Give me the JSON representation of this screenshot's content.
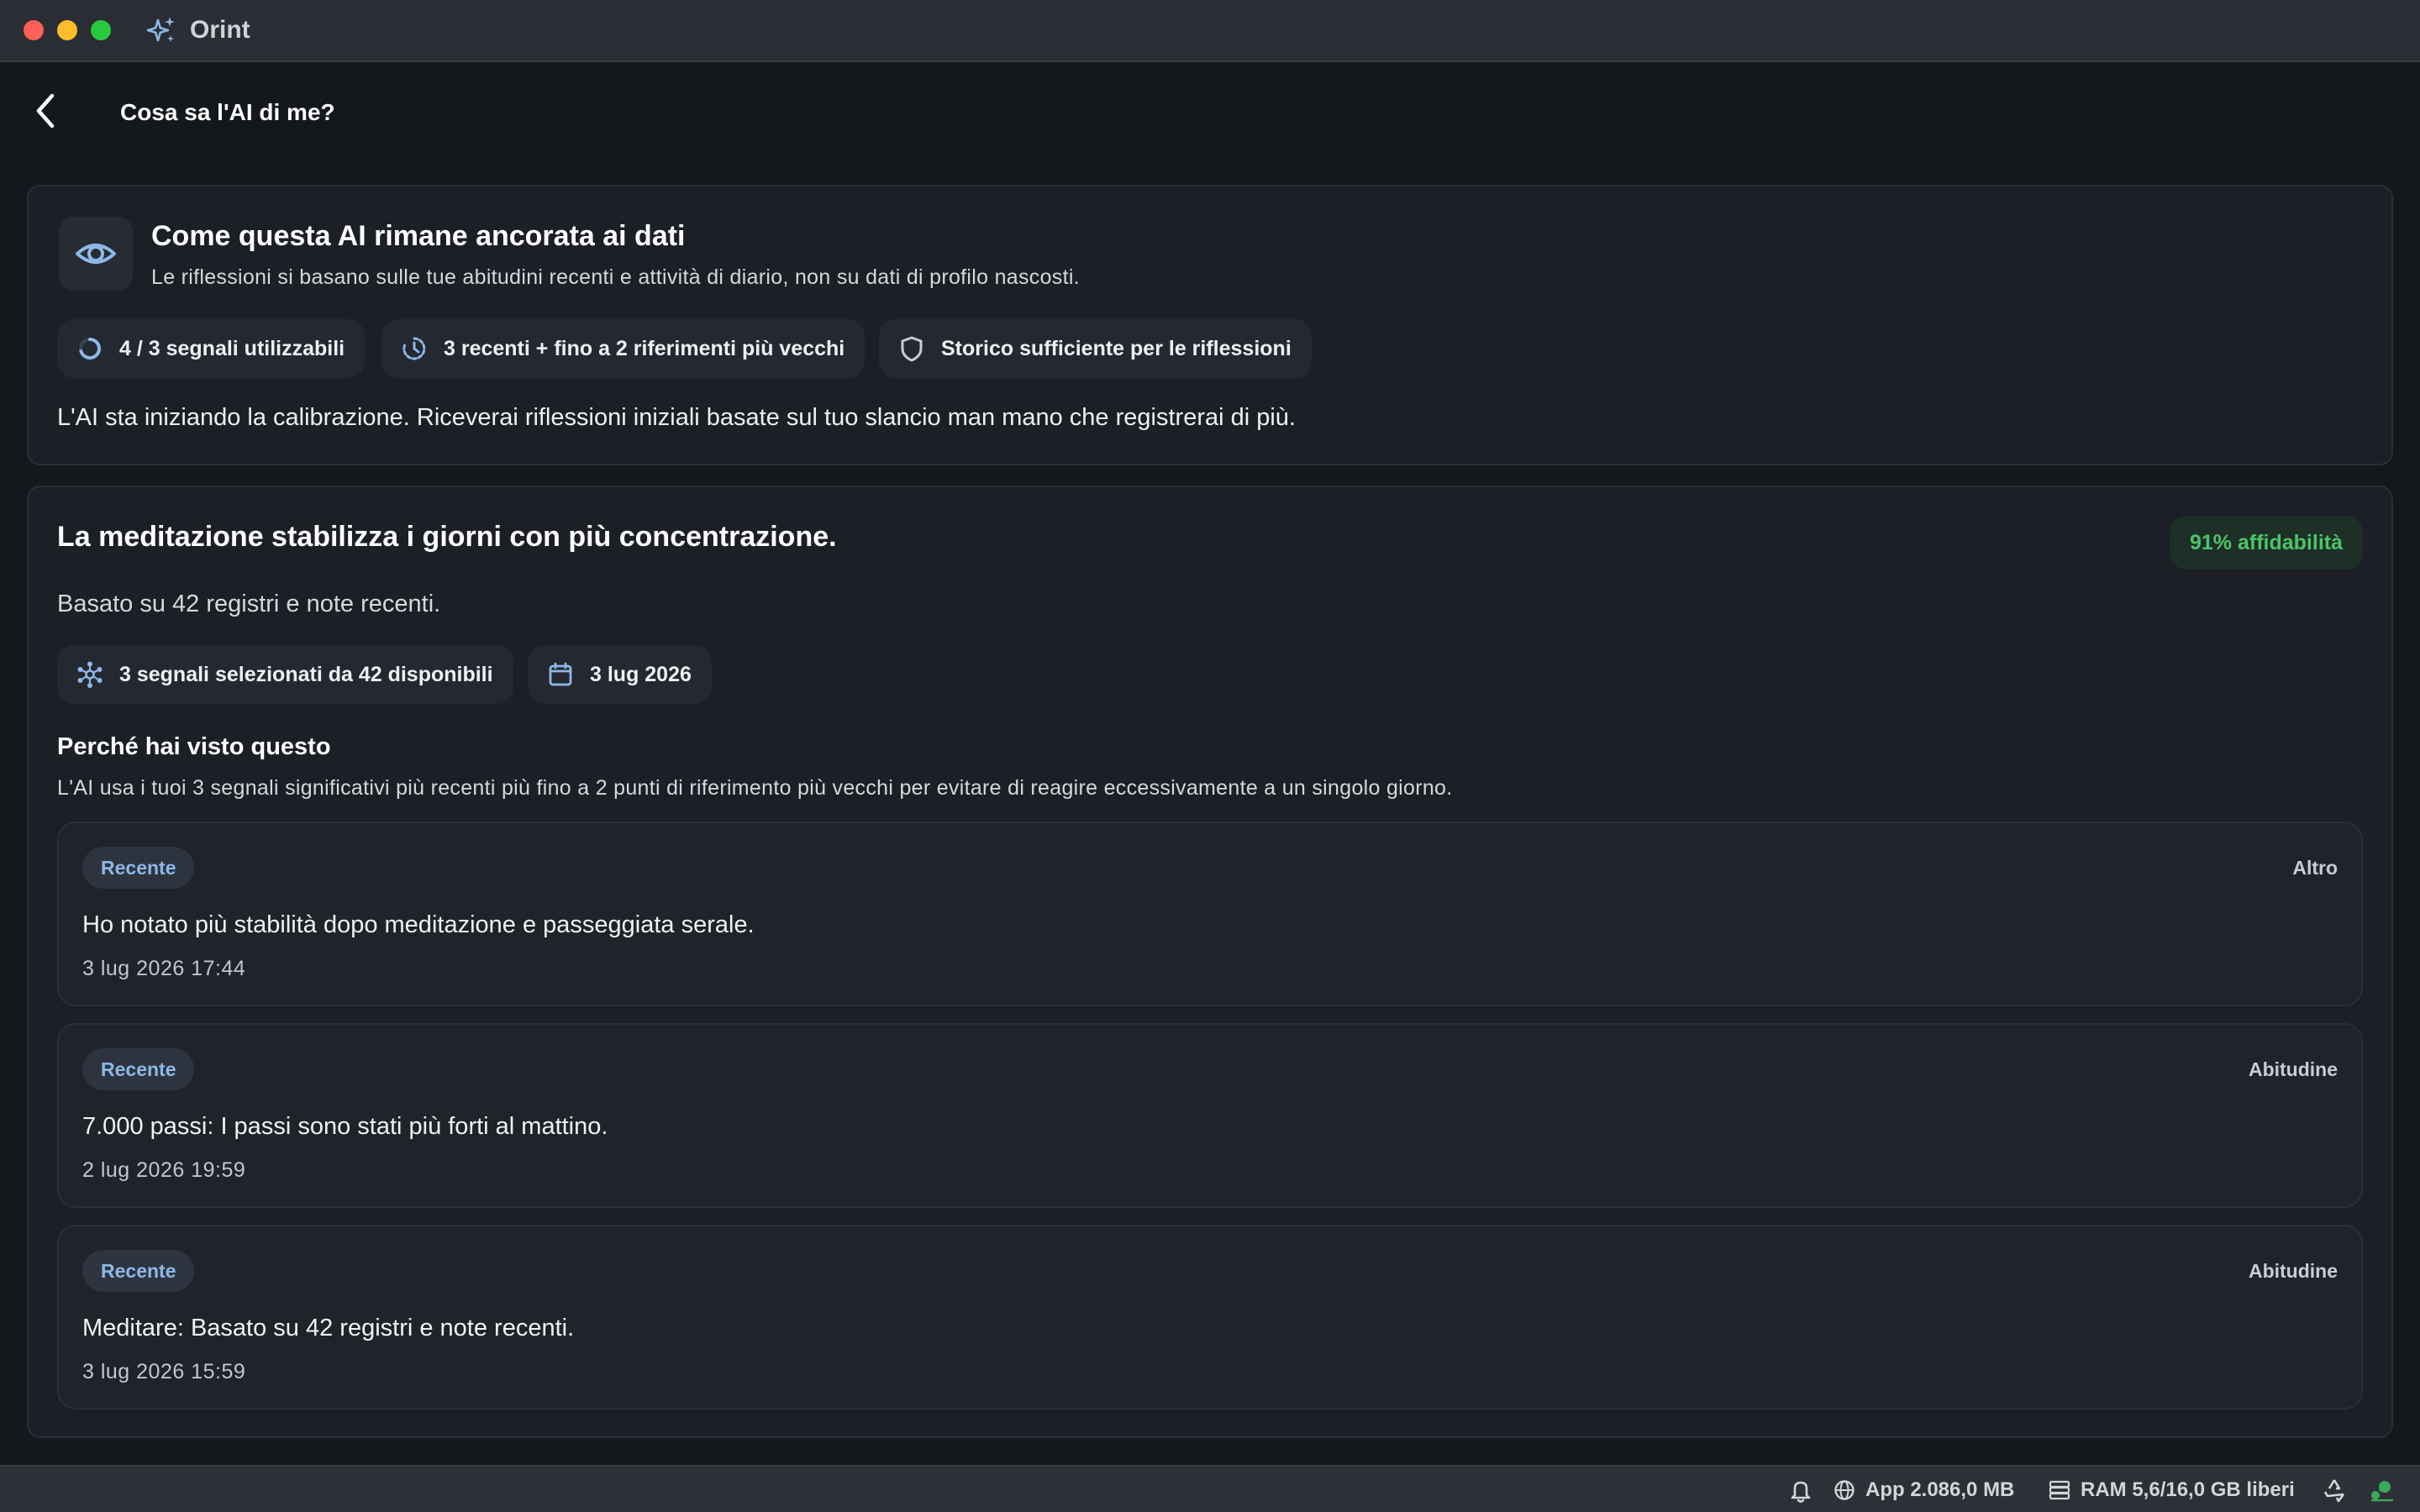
{
  "window": {
    "app_name": "Orint",
    "traffic_lights": [
      "#fe5f57",
      "#febc2e",
      "#28c840"
    ],
    "accent": "#8fb7e6"
  },
  "header": {
    "back_icon": "chevron-left-icon",
    "title": "Cosa sa l'AI di me?"
  },
  "grounding": {
    "icon": "eye-icon",
    "title": "Come questa AI rimane ancorata ai dati",
    "subtitle": "Le riflessioni si basano sulle tue abitudini recenti e attività di diario, non su dati di profilo nascosti.",
    "chips": [
      {
        "icon": "progress-ring-icon",
        "label": "4 / 3 segnali utilizzabili"
      },
      {
        "icon": "clock-history-icon",
        "label": "3 recenti + fino a 2 riferimenti più vecchi"
      },
      {
        "icon": "shield-icon",
        "label": "Storico sufficiente per le riflessioni"
      }
    ],
    "message": "L'AI sta iniziando la calibrazione. Riceverai riflessioni iniziali basate sul tuo slancio man mano che registrerai di più."
  },
  "insight": {
    "title": "La meditazione stabilizza i giorni con più concentrazione.",
    "reliability": "91% affidabilità",
    "reliability_color": "#4cc46a",
    "basis": "Basato su 42 registri e note recenti.",
    "chips": [
      {
        "icon": "network-nodes-icon",
        "label": "3 segnali selezionati da 42 disponibili"
      },
      {
        "icon": "calendar-icon",
        "label": "3 lug 2026"
      }
    ],
    "why_title": "Perché hai visto questo",
    "why_text": "L'AI usa i tuoi 3 segnali significativi più recenti più fino a 2 punti di riferimento più vecchi per evitare di reagire eccessivamente a un singolo giorno.",
    "observations": [
      {
        "badge": "Recente",
        "category": "Altro",
        "text": "Ho notato più stabilità dopo meditazione e passeggiata serale.",
        "time": "3 lug 2026 17:44"
      },
      {
        "badge": "Recente",
        "category": "Abitudine",
        "text": "7.000 passi: I passi sono stati più forti al mattino.",
        "time": "2 lug 2026 19:59"
      },
      {
        "badge": "Recente",
        "category": "Abitudine",
        "text": "Meditare: Basato su 42 registri e note recenti.",
        "time": "3 lug 2026 15:59"
      }
    ]
  },
  "statusbar": {
    "bell_icon": "bell-icon",
    "app_memory": "App 2.086,0 MB",
    "ram": "RAM 5,6/16,0 GB liberi",
    "recycle_icon": "recycle-icon",
    "status_icon": "network-status-icon"
  }
}
